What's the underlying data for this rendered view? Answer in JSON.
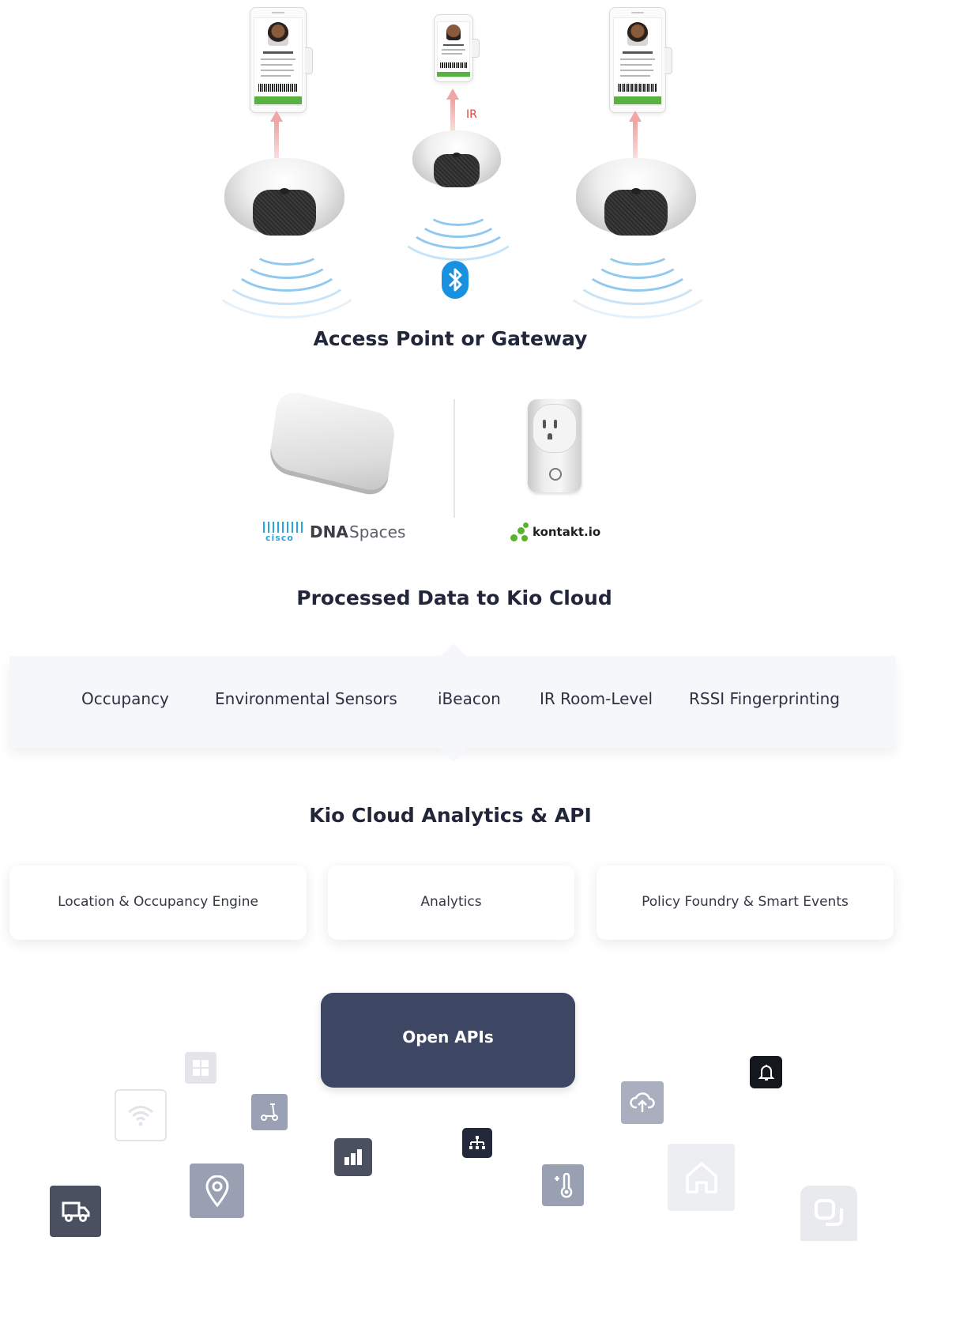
{
  "top": {
    "ir_label": "IR",
    "section_title": "Access Point or Gateway"
  },
  "gateways": {
    "cisco_small": "cisco",
    "cisco_brand_bold": "DNA",
    "cisco_brand_light": "Spaces",
    "kontakt_brand": "kontakt.io"
  },
  "processed": {
    "title": "Processed Data to Kio Cloud",
    "items": [
      "Occupancy",
      "Environmental Sensors",
      "iBeacon",
      "IR Room-Level",
      "RSSI Fingerprinting"
    ]
  },
  "analytics": {
    "title": "Kio Cloud Analytics & API",
    "cards": [
      "Location & Occupancy Engine",
      "Analytics",
      "Policy Foundry & Smart Events"
    ]
  },
  "api": {
    "label": "Open APIs"
  },
  "icons": [
    "grid-icon",
    "wifi-icon",
    "scooter-icon",
    "bar-chart-icon",
    "location-pin-icon",
    "truck-icon",
    "network-icon",
    "cloud-upload-icon",
    "thermometer-icon",
    "bell-icon",
    "home-icon",
    "layers-icon"
  ],
  "colors": {
    "accent_dark": "#3d4763",
    "wave_blue": "#8fc9ef",
    "bluetooth_blue": "#1791e0",
    "ir_red": "#e0463f",
    "kontakt_green": "#58b32e",
    "cisco_blue": "#27a6dc"
  }
}
